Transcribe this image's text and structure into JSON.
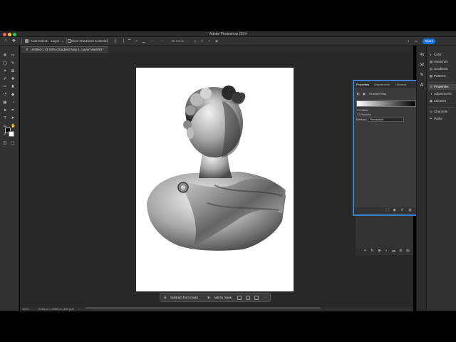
{
  "app": {
    "title": "Adobe Photoshop 2024"
  },
  "options_bar": {
    "auto_select_label": "Auto-Select:",
    "auto_select_value": "Layer",
    "show_transform_label": "Show Transform Controls",
    "mode_3d_label": "3D Mode:",
    "share_label": "Share"
  },
  "document_tab": {
    "label": "Untitled-1 @ 50% (Gradient Map 1, Layer Mask/8) *"
  },
  "status_bar": {
    "zoom": "50%",
    "doc_size": "2480 px x 3508 px (300 ppi)"
  },
  "context_bar": {
    "subtract_label": "Subtract from mask",
    "add_label": "Add to mask",
    "more_label": "···"
  },
  "properties_panel": {
    "tabs": [
      "Properties",
      "Adjustments",
      "Libraries"
    ],
    "active_tab": 0,
    "section_title": "Gradient Map",
    "dither_label": "Dither",
    "reverse_label": "Reverse",
    "method_label": "Method:",
    "method_value": "Perceptual"
  },
  "right_dock": {
    "items": [
      "Color",
      "Swatches",
      "Gradients",
      "Patterns",
      "Properties",
      "Adjustments",
      "Libraries",
      "Channels",
      "Paths"
    ],
    "active": "Properties"
  },
  "colors": {
    "accent": "#3f7fd0",
    "share": "#1473e6",
    "canvas_bg": "#282828",
    "panel_bg": "#323232"
  }
}
